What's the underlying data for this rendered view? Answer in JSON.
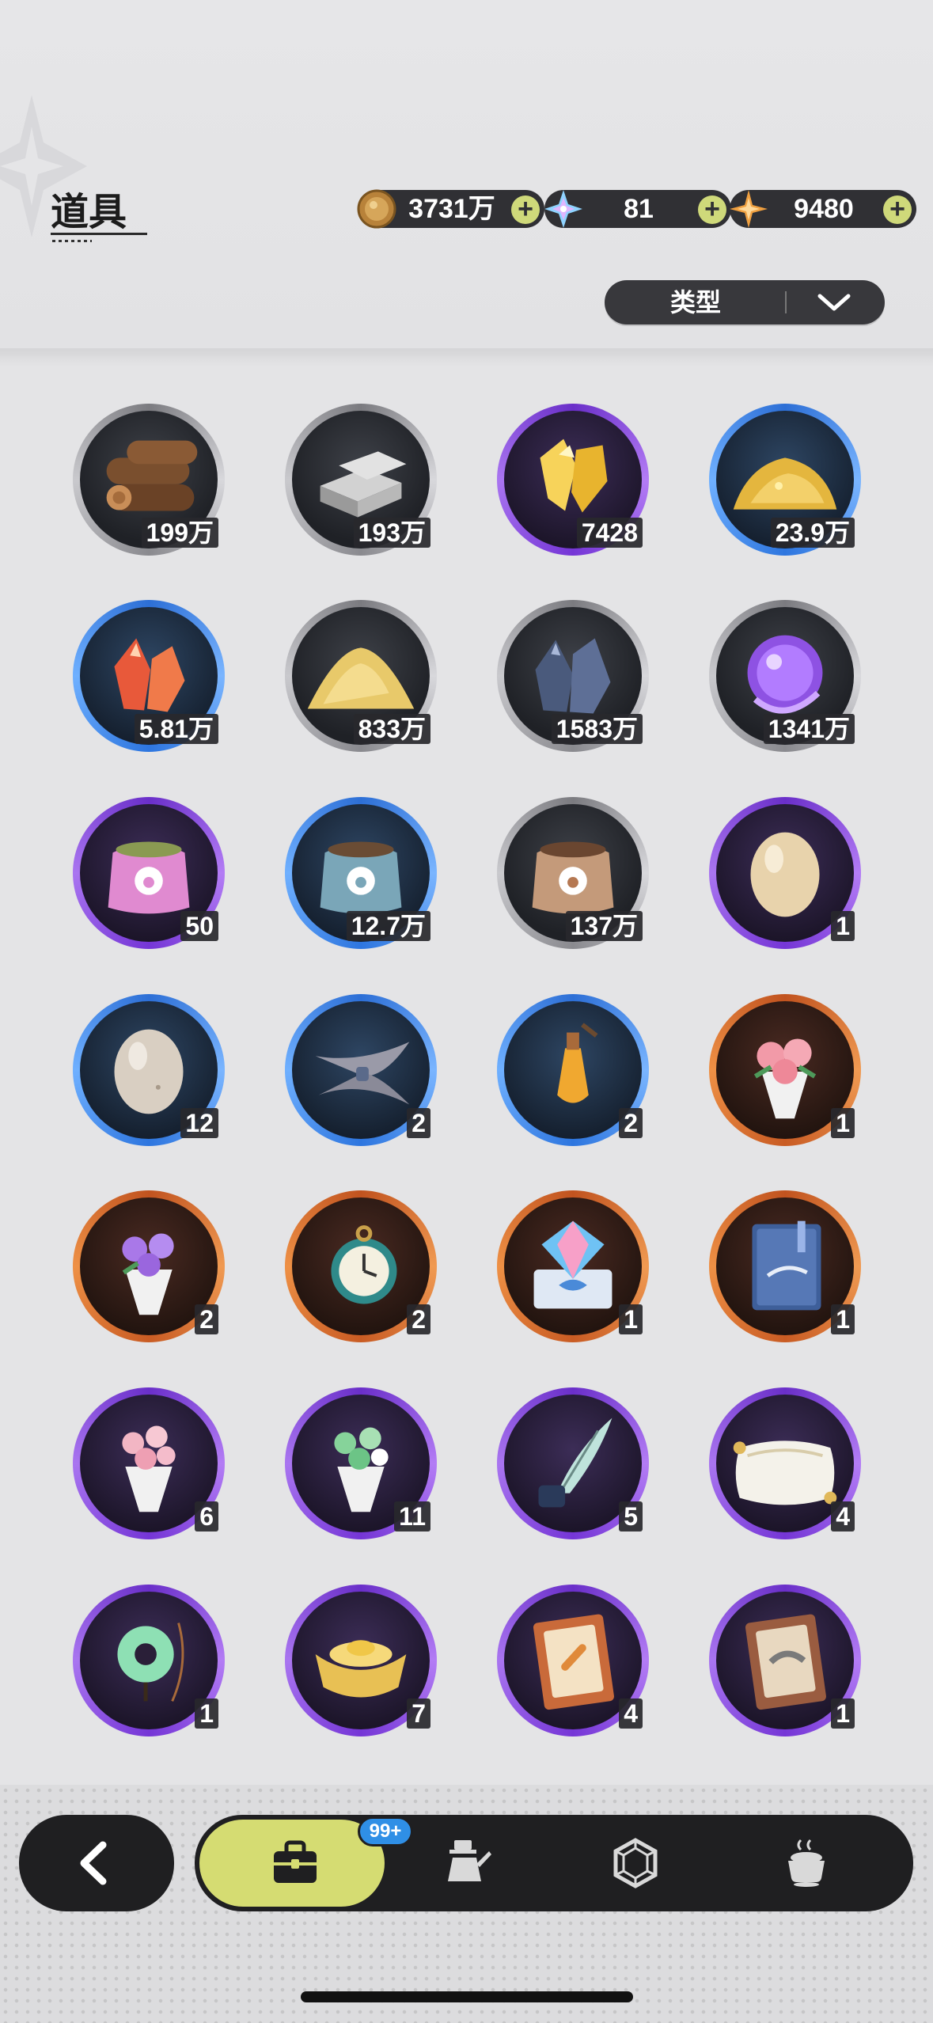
{
  "header": {
    "title": "道具",
    "currencies": [
      {
        "icon": "gold-coin-icon",
        "value": "3731万"
      },
      {
        "icon": "star-crystal-icon",
        "value": "81"
      },
      {
        "icon": "orange-star-icon",
        "value": "9480"
      }
    ],
    "plus_label": "+"
  },
  "filter": {
    "label": "类型"
  },
  "items": [
    {
      "name": "wood-logs",
      "count": "199万",
      "rarity": "grey"
    },
    {
      "name": "stone-bricks",
      "count": "193万",
      "rarity": "grey"
    },
    {
      "name": "gold-crystal",
      "count": "7428",
      "rarity": "purple"
    },
    {
      "name": "gold-nugget-pile",
      "count": "23.9万",
      "rarity": "blue"
    },
    {
      "name": "red-crystal",
      "count": "5.81万",
      "rarity": "blue"
    },
    {
      "name": "sand-pile",
      "count": "833万",
      "rarity": "grey"
    },
    {
      "name": "dark-crystal",
      "count": "1583万",
      "rarity": "grey"
    },
    {
      "name": "purple-orb",
      "count": "1341万",
      "rarity": "grey"
    },
    {
      "name": "pink-feed-bag",
      "count": "50",
      "rarity": "purple"
    },
    {
      "name": "blue-feed-bag",
      "count": "12.7万",
      "rarity": "blue"
    },
    {
      "name": "brown-feed-bag",
      "count": "137万",
      "rarity": "grey"
    },
    {
      "name": "cream-egg",
      "count": "1",
      "rarity": "purple"
    },
    {
      "name": "plain-egg",
      "count": "12",
      "rarity": "blue"
    },
    {
      "name": "grey-feather-bundle",
      "count": "2",
      "rarity": "blue"
    },
    {
      "name": "potion-vial",
      "count": "2",
      "rarity": "blue"
    },
    {
      "name": "pink-rose-bouquet",
      "count": "1",
      "rarity": "orange"
    },
    {
      "name": "purple-flower-bouquet",
      "count": "2",
      "rarity": "orange"
    },
    {
      "name": "pocket-watch",
      "count": "2",
      "rarity": "orange"
    },
    {
      "name": "diamond-gift-box",
      "count": "1",
      "rarity": "orange"
    },
    {
      "name": "blue-book",
      "count": "1",
      "rarity": "orange"
    },
    {
      "name": "cherry-blossom-bouquet",
      "count": "6",
      "rarity": "purple"
    },
    {
      "name": "green-flower-bouquet",
      "count": "11",
      "rarity": "purple"
    },
    {
      "name": "quill-and-ink",
      "count": "5",
      "rarity": "purple"
    },
    {
      "name": "pillow",
      "count": "4",
      "rarity": "purple"
    },
    {
      "name": "jade-pendant",
      "count": "1",
      "rarity": "purple"
    },
    {
      "name": "gold-ingot",
      "count": "7",
      "rarity": "purple"
    },
    {
      "name": "orange-recipe-book",
      "count": "4",
      "rarity": "purple"
    },
    {
      "name": "brown-recipe-book",
      "count": "1",
      "rarity": "purple"
    }
  ],
  "bottom_nav": {
    "badge": "99+",
    "tabs": [
      {
        "icon": "bag-icon",
        "active": true
      },
      {
        "icon": "costume-icon",
        "active": false
      },
      {
        "icon": "gem-icon",
        "active": false
      },
      {
        "icon": "cooking-pot-icon",
        "active": false
      }
    ]
  },
  "colors": {
    "accent": "#d5dc72",
    "badge": "#2f8fe6",
    "grey_ring": "#bdbdc2",
    "blue_ring": "#4d8ff0",
    "purple_ring": "#8e52e3",
    "orange_ring": "#de7a36"
  }
}
